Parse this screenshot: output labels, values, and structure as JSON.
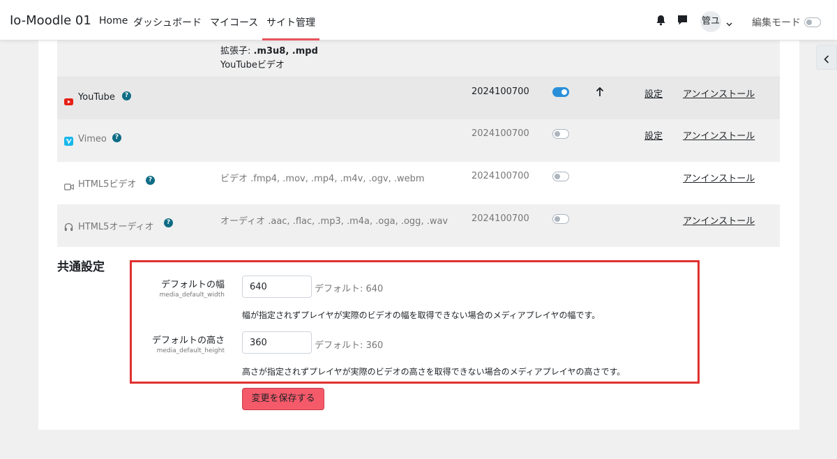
{
  "navbar": {
    "brand": "Io-Moodle 01",
    "items": [
      {
        "label": "Home"
      },
      {
        "label": "ダッシュボード"
      },
      {
        "label": "マイコース"
      },
      {
        "label": "サイト管理"
      }
    ],
    "user_initials": "管ユ",
    "edit_mode_label": "編集モード"
  },
  "top_row": {
    "extensions_label": "拡張子: ",
    "extensions_value": ".m3u8, .mpd",
    "desc": "YouTubeビデオ"
  },
  "players": [
    {
      "name": "YouTube",
      "icon": "youtube-icon",
      "desc": "",
      "version": "2024100700",
      "enabled": true,
      "settings": "設定",
      "uninstall": "アンインストール"
    },
    {
      "name": "Vimeo",
      "icon": "vimeo-icon",
      "desc": "",
      "version": "2024100700",
      "enabled": false,
      "settings": "設定",
      "uninstall": "アンインストール"
    },
    {
      "name": "HTML5ビデオ",
      "icon": "video-camera-icon",
      "desc": "ビデオ .fmp4, .mov, .mp4, .m4v, .ogv, .webm",
      "version": "2024100700",
      "enabled": false,
      "settings": "",
      "uninstall": "アンインストール"
    },
    {
      "name": "HTML5オーディオ",
      "icon": "headphones-icon",
      "desc": "オーディオ .aac, .flac, .mp3, .m4a, .oga, .ogg, .wav",
      "version": "2024100700",
      "enabled": false,
      "settings": "",
      "uninstall": "アンインストール"
    }
  ],
  "common": {
    "title": "共通設定",
    "width": {
      "label": "デフォルトの幅",
      "key": "media_default_width",
      "value": "640",
      "default": "デフォルト: 640",
      "desc": "幅が指定されずプレイヤが実際のビデオの幅を取得できない場合のメディアプレイヤの幅です。"
    },
    "height": {
      "label": "デフォルトの高さ",
      "key": "media_default_height",
      "value": "360",
      "default": "デフォルト: 360",
      "desc": "高さが指定されずプレイヤが実際のビデオの高さを取得できない場合のメディアプレイヤの高さです。"
    },
    "save_label": "変更を保存する"
  },
  "colors": {
    "accent": "#e8535c",
    "toggle_on": "#2a8fd9",
    "highlight_box": "#e03030",
    "save_button": "#f55a6a"
  }
}
